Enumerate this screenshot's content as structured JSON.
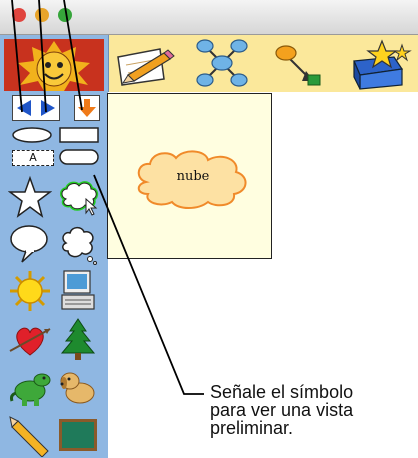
{
  "window": {
    "traffic_lights": [
      {
        "name": "close",
        "color": "#e0443e"
      },
      {
        "name": "minimize",
        "color": "#e8a42a"
      },
      {
        "name": "zoom",
        "color": "#36a53a"
      }
    ]
  },
  "toolbar": {
    "buttons": [
      "pencil-paper-icon",
      "rapid-create-icon",
      "link-arrow-icon",
      "symbol-library-icon"
    ]
  },
  "palette": {
    "nav": [
      "previous-arrow-icon",
      "next-arrow-icon",
      "menu-arrow-icon"
    ],
    "label_text": "A",
    "symbols": [
      "oval-shape",
      "rectangle-shape",
      "text-label-shape",
      "rounded-rectangle-shape",
      "star-icon",
      "cloud-icon",
      "speech-bubble-icon",
      "thought-bubble-icon",
      "sun-icon",
      "computer-icon",
      "heart-arrow-icon",
      "tree-icon",
      "dinosaur-icon",
      "dog-icon",
      "pencil-icon",
      "chalkboard-icon"
    ],
    "selected": "cloud-icon"
  },
  "canvas": {
    "symbol_label": "nube"
  },
  "callout": {
    "line1": "Señale el símbolo",
    "line2": "para ver una vista",
    "line3": "preliminar."
  },
  "colors": {
    "palette_bg": "#8fb7e2",
    "toolbar_bg": "#fbe89b",
    "page_bg": "#fffee0",
    "cloud_outline": "#f08a2a",
    "selection": "#22cc22"
  }
}
